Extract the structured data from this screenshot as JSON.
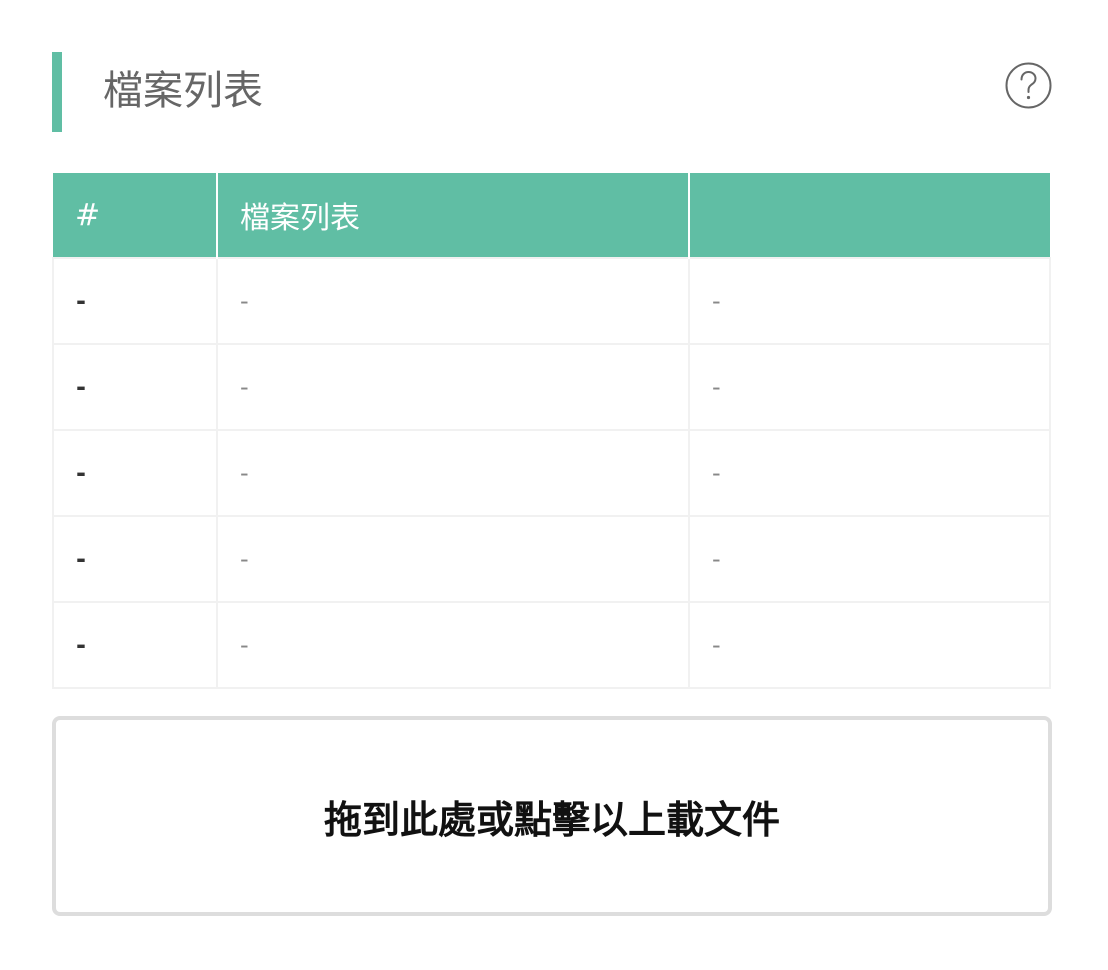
{
  "colors": {
    "accent": "#60bea4",
    "title_text": "#666666",
    "border": "#f1f1f1"
  },
  "section": {
    "title": "檔案列表",
    "help_icon": "question-circle-icon"
  },
  "table": {
    "headers": [
      "#",
      "檔案列表",
      ""
    ],
    "rows": [
      [
        "-",
        "-",
        "-"
      ],
      [
        "-",
        "-",
        "-"
      ],
      [
        "-",
        "-",
        "-"
      ],
      [
        "-",
        "-",
        "-"
      ],
      [
        "-",
        "-",
        "-"
      ]
    ]
  },
  "upload": {
    "label": "拖到此處或點擊以上載文件"
  }
}
